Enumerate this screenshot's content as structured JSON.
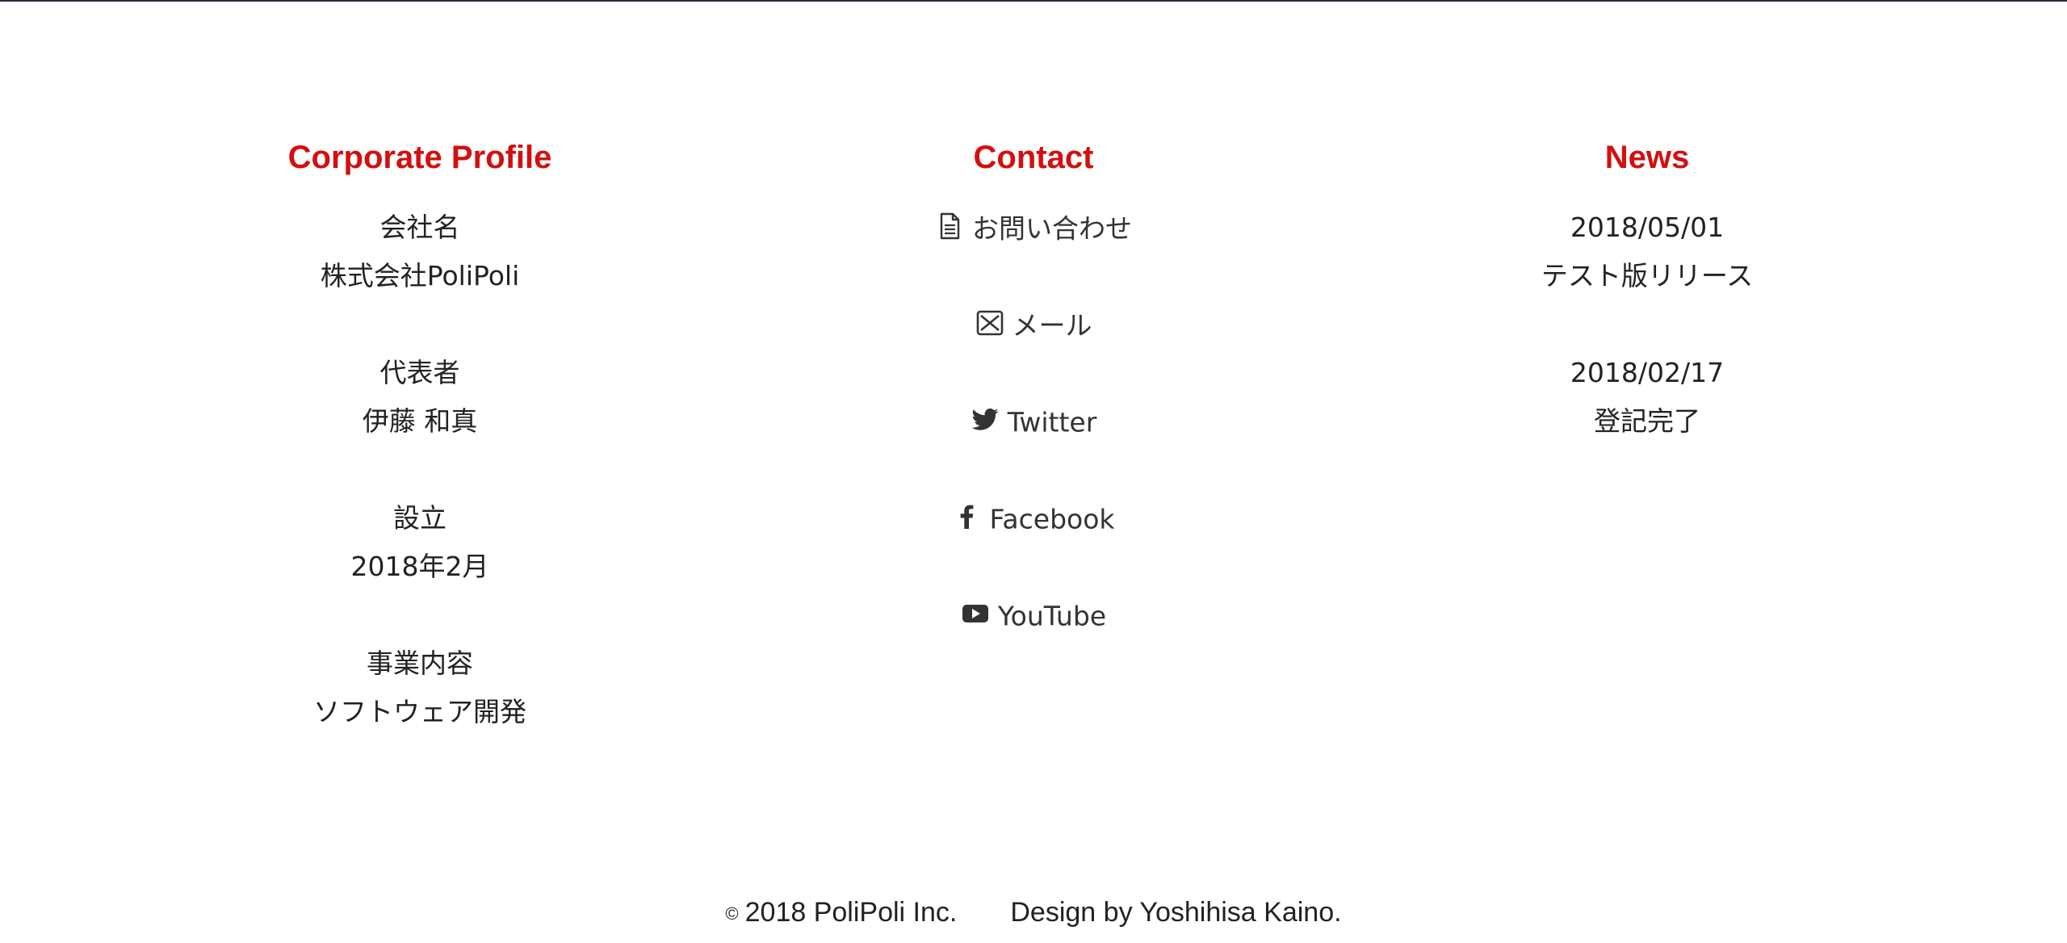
{
  "profile": {
    "title": "Corporate Profile",
    "entries": [
      {
        "label": "会社名",
        "value": "株式会社PoliPoli"
      },
      {
        "label": "代表者",
        "value": "伊藤 和真"
      },
      {
        "label": "設立",
        "value": "2018年2月"
      },
      {
        "label": "事業内容",
        "value": "ソフトウェア開発"
      }
    ]
  },
  "contact": {
    "title": "Contact",
    "items": [
      {
        "label": "お問い合わせ",
        "icon": "document-icon"
      },
      {
        "label": "メール",
        "icon": "mail-icon"
      },
      {
        "label": "Twitter",
        "icon": "twitter-icon"
      },
      {
        "label": "Facebook",
        "icon": "facebook-icon"
      },
      {
        "label": "YouTube",
        "icon": "youtube-icon"
      }
    ]
  },
  "news": {
    "title": "News",
    "entries": [
      {
        "date": "2018/05/01",
        "text": "テスト版リリース"
      },
      {
        "date": "2018/02/17",
        "text": "登記完了"
      }
    ]
  },
  "footer": {
    "copyright_symbol": "©",
    "copyright": "2018 PoliPoli Inc.",
    "credit": "Design by Yoshihisa Kaino."
  },
  "colors": {
    "heading": "#d30f0f",
    "text": "#222222",
    "border": "#2a2a3a"
  }
}
